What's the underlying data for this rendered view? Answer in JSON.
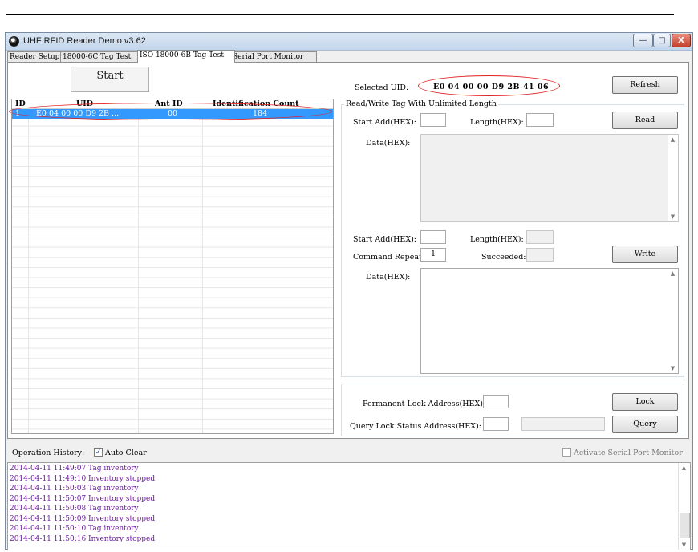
{
  "window": {
    "title": "UHF RFID Reader Demo v3.62",
    "minimize": "—",
    "maximize": "□",
    "close": "X"
  },
  "tabs": [
    "Reader Setup",
    "18000-6C Tag Test",
    "ISO 18000-6B Tag Test",
    "Serial Port Monitor"
  ],
  "active_tab": "ISO 18000-6B Tag Test",
  "start_label": "Start",
  "grid": {
    "headers": [
      "ID",
      "UID",
      "Ant ID",
      "Identification Count"
    ],
    "rows": [
      {
        "id": "1",
        "uid": "E0 04 00 00 D9 2B ...",
        "ant_id": "00",
        "count": "184"
      }
    ]
  },
  "selected_uid": {
    "label": "Selected UID:",
    "value": "E0 04 00 00 D9 2B 41 06"
  },
  "refresh_label": "Refresh",
  "rw_group": {
    "title": "Read/Write Tag With Unlimited Length",
    "start_add_label": "Start Add(HEX):",
    "length_label": "Length(HEX):",
    "data_label": "Data(HEX):",
    "read_label": "Read",
    "start_add2_label": "Start Add(HEX):",
    "length2_label": "Length(HEX):",
    "command_repeat_label": "Command Repeat:",
    "command_repeat_value": "1",
    "succeeded_label": "Succeeded:",
    "data2_label": "Data(HEX):",
    "write_label": "Write"
  },
  "lock_group": {
    "permanent_label": "Permanent Lock Address(HEX):",
    "lock_label": "Lock",
    "query_status_label": "Query Lock Status Address(HEX):",
    "query_label": "Query"
  },
  "history": {
    "label": "Operation History:",
    "auto_clear_label": "Auto Clear",
    "auto_clear_checked": true,
    "monitor_label": "Activate Serial Port Monitor",
    "monitor_checked": false,
    "lines": [
      "2014-04-11 11:49:07 Tag inventory",
      "2014-04-11 11:49:10 Inventory stopped",
      "2014-04-11 11:50:03 Tag inventory",
      "2014-04-11 11:50:07 Inventory stopped",
      "2014-04-11 11:50:08 Tag inventory",
      "2014-04-11 11:50:09 Inventory stopped",
      "2014-04-11 11:50:10 Tag inventory",
      "2014-04-11 11:50:16 Inventory stopped"
    ]
  },
  "colors": {
    "selection": "#3399ff",
    "highlight_ellipse": "#e02020",
    "log_text": "#6a1b9a"
  }
}
